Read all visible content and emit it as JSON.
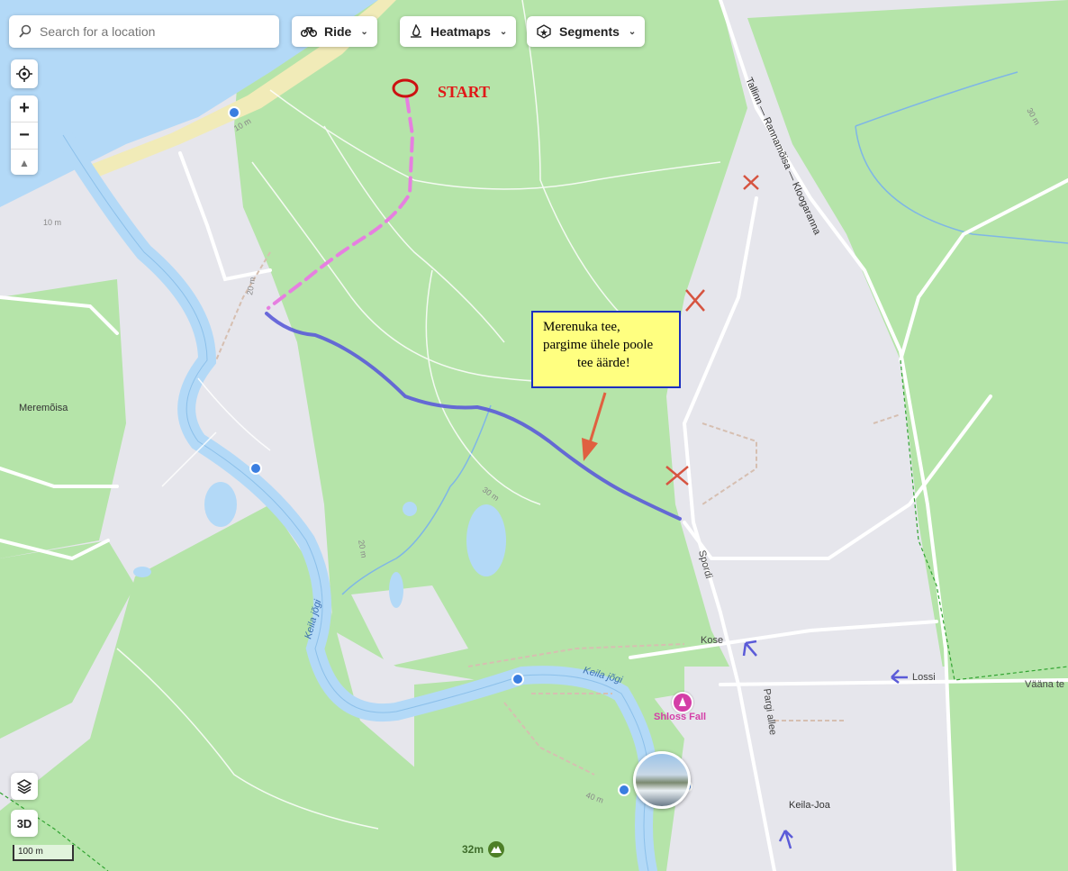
{
  "search": {
    "placeholder": "Search for a location",
    "icon": "search-icon"
  },
  "toolbar": {
    "ride": {
      "label": "Ride",
      "icon": "bike-icon"
    },
    "heatmaps": {
      "label": "Heatmaps",
      "icon": "heatmap-flame-icon"
    },
    "segments": {
      "label": "Segments",
      "icon": "segment-star-icon"
    }
  },
  "controls": {
    "locate_icon": "crosshair-icon",
    "zoom_in": "+",
    "zoom_out": "−",
    "compass": "▲",
    "layers_icon": "layers-icon",
    "three_d": "3D",
    "scale": "100 m"
  },
  "annotations": {
    "start": "START",
    "note_lines": [
      "Merenuka tee,",
      "pargime ühele poole",
      "tee äärde!"
    ]
  },
  "places": {
    "meremoisa": "Meremõisa",
    "keila_joa": "Keila-Joa",
    "poi": "Shloss Fall",
    "peak": "32m"
  },
  "roads": {
    "highway": "Tallinn — Rannamõisa — Kloogaranna",
    "spordi": "Spordi",
    "kose": "Kose",
    "lossi": "Lossi",
    "vaana": "Vääna te",
    "pargi": "Pargi allee",
    "river1": "Keila jõgi",
    "river2": "Keila jõgi"
  },
  "contours": {
    "c1": "10 m",
    "c2": "10 m",
    "c3": "20 m",
    "c4": "20 m",
    "c5": "30 m",
    "c6": "40 m",
    "c7": "30 m"
  },
  "colors": {
    "water": "#b3d9f7",
    "forest": "#b5e4a9",
    "ground": "#e6e6ec",
    "route": "#5b5bd8",
    "planned": "#e67fe0",
    "sand": "#f1ebb8",
    "accent": "#d43ea7",
    "start": "#e01818"
  }
}
